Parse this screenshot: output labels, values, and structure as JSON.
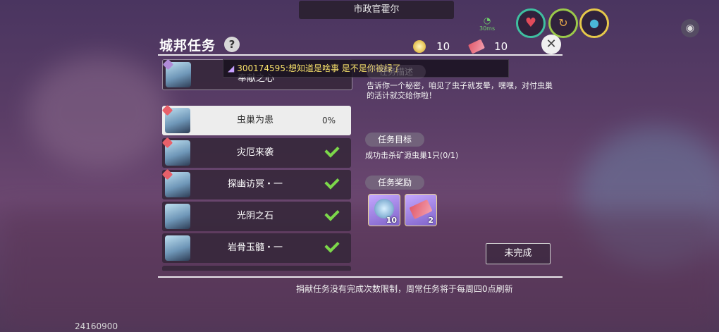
{
  "top_bar": {
    "npc_name": "市政官霍尔"
  },
  "header": {
    "title": "城邦任务",
    "help_label": "?",
    "close_label": "✕"
  },
  "currency": [
    {
      "icon": "coin-icon",
      "value": "10"
    },
    {
      "icon": "ticket-icon",
      "value": "10"
    }
  ],
  "status": {
    "signal_label": "30ms"
  },
  "chat": {
    "message": "300174595:想知道是啥事 是不是你被绿了"
  },
  "tasks": [
    {
      "name": "奉献之心",
      "status": ""
    },
    {
      "name": "虫巢为患",
      "status": "0%"
    },
    {
      "name": "灾厄来袭",
      "status": "done"
    },
    {
      "name": "探幽访冥・一",
      "status": "done"
    },
    {
      "name": "光阴之石",
      "status": "done"
    },
    {
      "name": "岩骨玉髓・一",
      "status": "done"
    }
  ],
  "detail": {
    "description_header": "任务描述",
    "description": "告诉你一个秘密，咱见了虫子就发晕，嘿嘿，对付虫巢的活计就交给你啦！",
    "objective_header": "任务目标",
    "objective": "成功击杀矿源虫巢1只(0/1)",
    "reward_header": "任务奖励",
    "rewards": [
      {
        "icon": "coin-icon",
        "count": "10"
      },
      {
        "icon": "ticket-icon",
        "count": "2"
      }
    ],
    "button_label": "未完成"
  },
  "footer": {
    "notice": "捐献任务没有完成次数限制，周常任务将于每周四0点刷新",
    "uid": "24160900"
  }
}
